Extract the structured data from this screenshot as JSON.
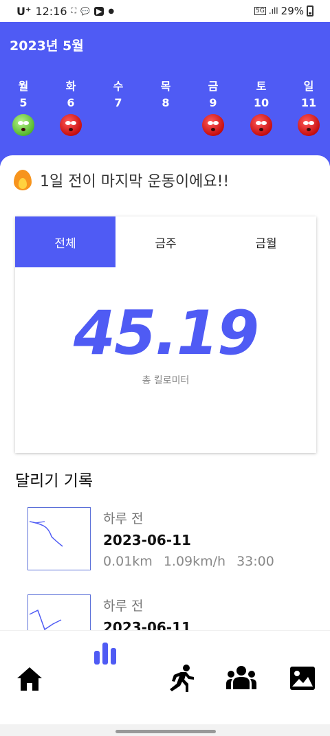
{
  "status_bar": {
    "carrier": "U⁺",
    "time": "12:16",
    "network": "5G",
    "battery": "29%"
  },
  "header": {
    "month_title": "2023년 5월",
    "days": [
      {
        "name": "월",
        "num": "5",
        "status": "good"
      },
      {
        "name": "화",
        "num": "6",
        "status": "bad"
      },
      {
        "name": "수",
        "num": "7",
        "status": "none"
      },
      {
        "name": "목",
        "num": "8",
        "status": "none"
      },
      {
        "name": "금",
        "num": "9",
        "status": "bad"
      },
      {
        "name": "토",
        "num": "10",
        "status": "bad"
      },
      {
        "name": "일",
        "num": "11",
        "status": "bad"
      }
    ]
  },
  "last_workout": {
    "icon": "fire-icon",
    "text": "1일 전이 마지막 운동이에요!!"
  },
  "stats": {
    "tabs": [
      {
        "label": "전체",
        "active": true
      },
      {
        "label": "금주",
        "active": false
      },
      {
        "label": "금월",
        "active": false
      }
    ],
    "value": "45.19",
    "unit": "총 킬로미터"
  },
  "records_title": "달리기 기록",
  "records": [
    {
      "ago": "하루 전",
      "date": "2023-06-11",
      "distance": "0.01km",
      "speed": "1.09km/h",
      "duration": "33:00"
    },
    {
      "ago": "하루 전",
      "date": "2023-06-11",
      "distance": "",
      "speed": "",
      "duration": ""
    }
  ],
  "nav": {
    "items": [
      "home-icon",
      "chart-icon",
      "running-icon",
      "group-icon",
      "gallery-icon"
    ],
    "active": "chart-icon"
  },
  "colors": {
    "accent": "#4f5bf4",
    "face_bad": "#d11a1a",
    "face_good": "#6fcf3c"
  }
}
